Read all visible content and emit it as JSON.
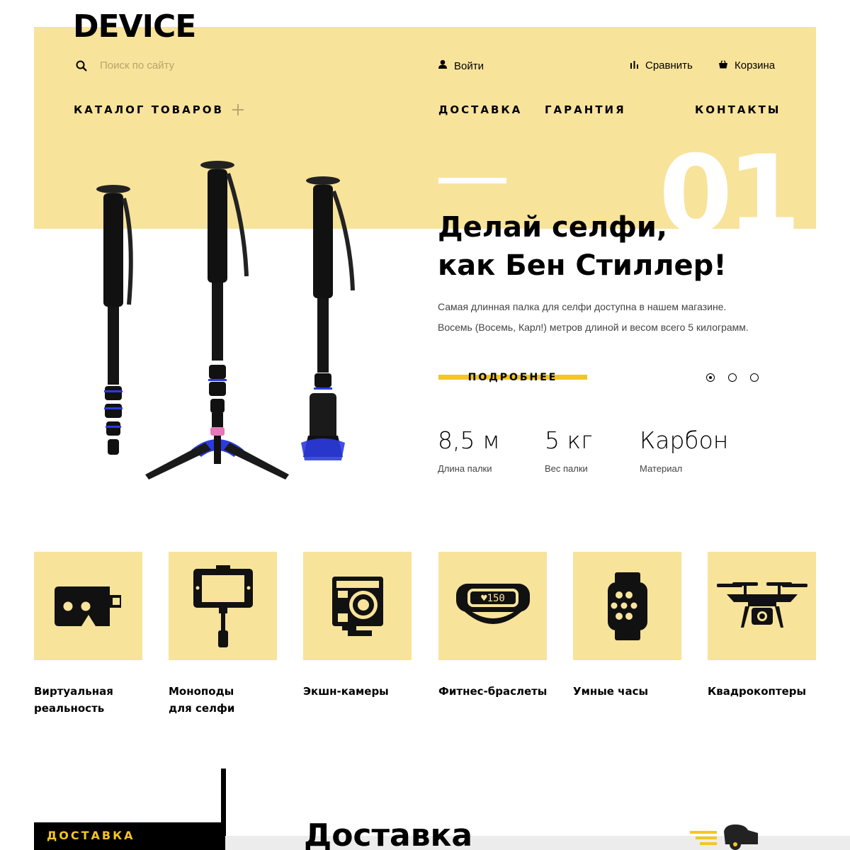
{
  "header": {
    "logo": "DEVICE",
    "search_placeholder": "Поиск по сайту",
    "login_label": "Войти",
    "compare_label": "Сравнить",
    "cart_label": "Корзина"
  },
  "nav": {
    "catalog": "КАТАЛОГ ТОВАРОВ",
    "delivery": "ДОСТАВКА",
    "warranty": "ГАРАНТИЯ",
    "contacts": "КОНТАКТЫ"
  },
  "slider": {
    "number": "01",
    "title_line1": "Делай селфи,",
    "title_line2": "как Бен Стиллер!",
    "desc_line1": "Самая длинная палка для селфи доступна в нашем магазине.",
    "desc_line2": "Восемь (Восемь, Карл!) метров длиной и весом всего 5 килограмм.",
    "more_label": "ПОДРОБНЕЕ",
    "active_slide": 1,
    "slides_count": 3,
    "stats": [
      {
        "value": "8,5 м",
        "label": "Длина палки"
      },
      {
        "value": "5 кг",
        "label": "Вес палки"
      },
      {
        "value": "Карбон",
        "label": "Материал"
      }
    ]
  },
  "categories": [
    {
      "line1": "Виртуальная",
      "line2": "реальность",
      "icon": "vr-headset-icon"
    },
    {
      "line1": "Моноподы",
      "line2": "для селфи",
      "icon": "selfie-stick-icon"
    },
    {
      "line1": "Экшн-камеры",
      "line2": "",
      "icon": "action-camera-icon"
    },
    {
      "line1": "Фитнес-браслеты",
      "line2": "",
      "icon": "fitness-band-icon"
    },
    {
      "line1": "Умные часы",
      "line2": "",
      "icon": "smartwatch-icon"
    },
    {
      "line1": "Квадрокоптеры",
      "line2": "",
      "icon": "drone-icon"
    }
  ],
  "band_display": "♥150",
  "services": {
    "tab_label": "ДОСТАВКА",
    "heading": "Доставка"
  },
  "colors": {
    "accent_yellow": "#f8e39b",
    "button_yellow": "#f3c623",
    "text": "#000000"
  }
}
